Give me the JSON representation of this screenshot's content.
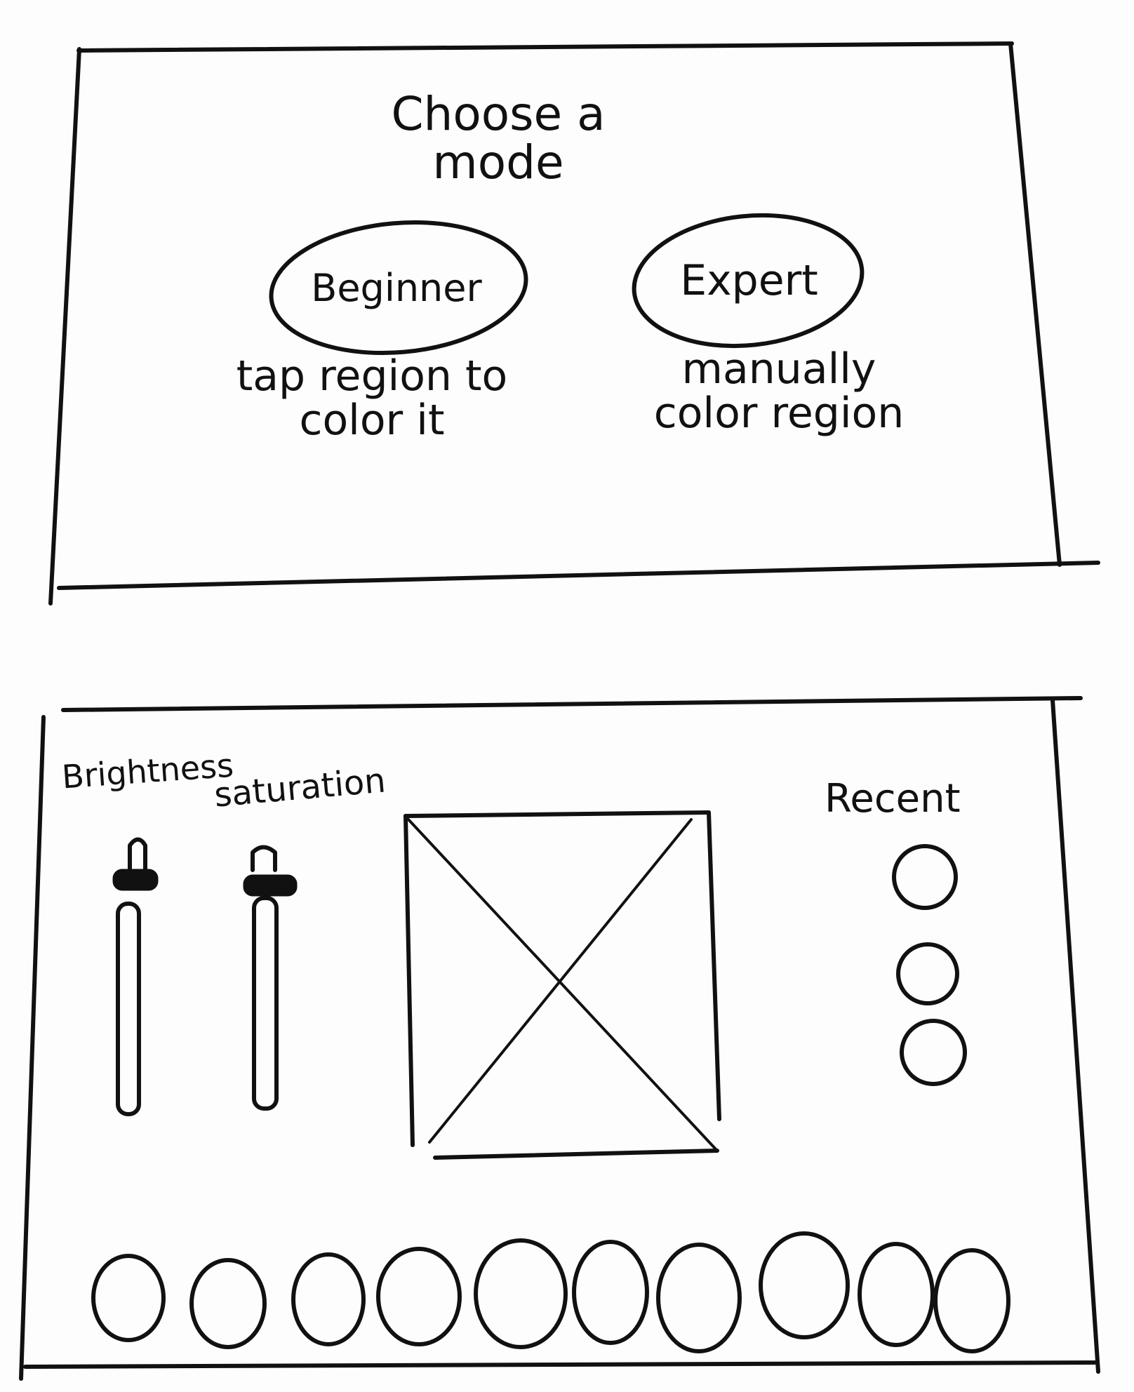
{
  "screen1": {
    "title": "Choose a mode",
    "modes": [
      {
        "label": "Beginner",
        "description": "tap region to color it"
      },
      {
        "label": "Expert",
        "description": "manually color region"
      }
    ]
  },
  "screen2": {
    "sliders": [
      {
        "label": "Brightness"
      },
      {
        "label": "saturation"
      }
    ],
    "recent": {
      "label": "Recent",
      "swatch_count": 3
    },
    "palette": {
      "swatch_count": 10
    }
  },
  "colors": {
    "ink": "#111111",
    "paper": "#fdfdfd"
  }
}
